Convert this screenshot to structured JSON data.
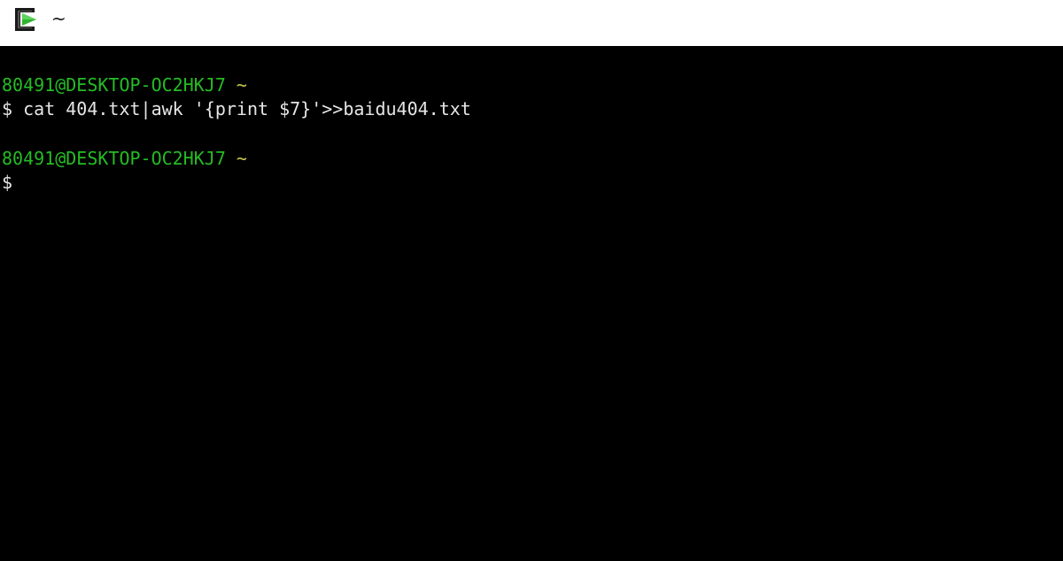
{
  "window": {
    "title": "~",
    "icon": "cygwin-terminal-icon"
  },
  "colors": {
    "titlebar_bg": "#ffffff",
    "terminal_bg": "#000000",
    "prompt_user": "#25bc24",
    "prompt_path": "#c8c844",
    "text": "#e6e6e6"
  },
  "terminal": {
    "blocks": [
      {
        "user_host": "80491@DESKTOP-OC2HKJ7",
        "path": "~",
        "prompt_symbol": "$",
        "command": "cat 404.txt|awk '{print $7}'>>baidu404.txt"
      },
      {
        "user_host": "80491@DESKTOP-OC2HKJ7",
        "path": "~",
        "prompt_symbol": "$",
        "command": ""
      }
    ]
  }
}
